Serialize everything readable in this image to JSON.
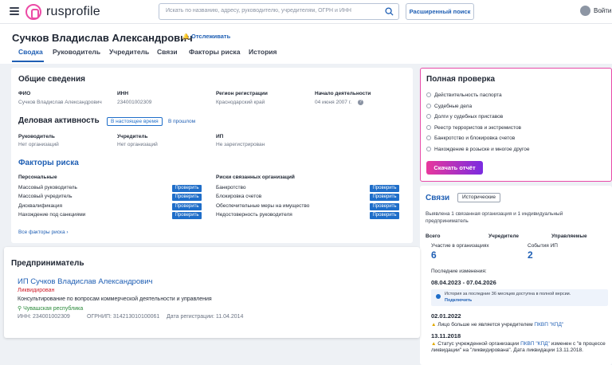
{
  "header": {
    "logo_text": "rusprofile",
    "search_placeholder": "Искать по названию, адресу, руководителю, учредителям, ОГРН и ИНН",
    "advanced_search": "Расширенный поиск",
    "login": "Войти"
  },
  "page": {
    "title": "Сучков Владислав Александрович",
    "track": "Отслеживать",
    "tabs": [
      "Сводка",
      "Руководитель",
      "Учредитель",
      "Связи",
      "Факторы риска",
      "История"
    ]
  },
  "general": {
    "title": "Общие сведения",
    "fio_label": "ФИО",
    "fio_value": "Сучков Владислав Александрович",
    "inn_label": "ИНН",
    "inn_value": "234001002309",
    "region_label": "Регион регистрации",
    "region_value": "Краснодарский край",
    "start_label": "Начало деятельности",
    "start_value": "04 июня 2007 г."
  },
  "business": {
    "title": "Деловая активность",
    "toggle_now": "В настоящее время",
    "toggle_past": "В прошлом",
    "head_label": "Руководитель",
    "head_value": "Нет организаций",
    "founder_label": "Учредитель",
    "founder_value": "Нет организаций",
    "ip_label": "ИП",
    "ip_value": "Не зарегистрирован"
  },
  "risk": {
    "title": "Факторы риска",
    "personal_label": "Персональные",
    "personal": [
      "Массовый руководитель",
      "Массовый учредитель",
      "Дисквалификация",
      "Нахождение под санкциями"
    ],
    "related_label": "Риски связанных организаций",
    "related": [
      "Банкротство",
      "Блокировка счетов",
      "Обеспечительные меры на имущество",
      "Недостоверность руководителя"
    ],
    "check_label": "Проверить",
    "all_link": "Все факторы риска"
  },
  "full_check": {
    "title": "Полная проверка",
    "items": [
      "Действительность паспорта",
      "Судебные дела",
      "Долги у судебных приставов",
      "Реестр террористов и экстремистов",
      "Банкротство и блокировка счетов",
      "Нахождение в розыске и многое другое"
    ],
    "button": "Скачать отчёт"
  },
  "links": {
    "title": "Связи",
    "historic": "Исторические",
    "desc": "Выявлена 1 связанная организация и 1 индивидуальный предприниматель",
    "cols": [
      "Всего",
      "Учредителе",
      "Управляемые"
    ],
    "participation_label": "Участие в организациях",
    "participation_value": "6",
    "ip_events_label": "События ИП",
    "ip_events_value": "2"
  },
  "history": {
    "changes_label": "Последние изменения:",
    "period": "08.04.2023 - 07.04.2026",
    "notice": "История за последние 36 месяцев доступна в полной версии.",
    "notice_link": "Подключить",
    "date1": "02.01.2022",
    "event1_text": "Лицо больше не является учредителем",
    "event1_link": "ПКВП \"КПД\"",
    "date2": "13.11.2018",
    "event2_a": "Статус учрежденной организации",
    "event2_link": "ПКВП \"КПД\"",
    "event2_b": "изменен с \"в процессе ликвидации\" на \"ликвидирована\". Дата ликвидации 13.11.2018."
  },
  "entrepreneur": {
    "title": "Предприниматель",
    "name": "ИП Сучков Владислав Александрович",
    "status": "Ликвидирован",
    "activity": "Консультирование по вопросам коммерческой деятельности и управления",
    "region": "Чувашская республика",
    "inn": "ИНН: 234001002309",
    "ogrnip": "ОГРНИП: 314213010100061",
    "reg_date": "Дата регистрации: 11.04.2014"
  },
  "colors": {
    "accent": "#1f5fb4",
    "button": "#1f6ec9",
    "brand_pink": "#ec4ba6",
    "download_btn": "#8a2bd8",
    "liquidated": "#d0202c"
  }
}
